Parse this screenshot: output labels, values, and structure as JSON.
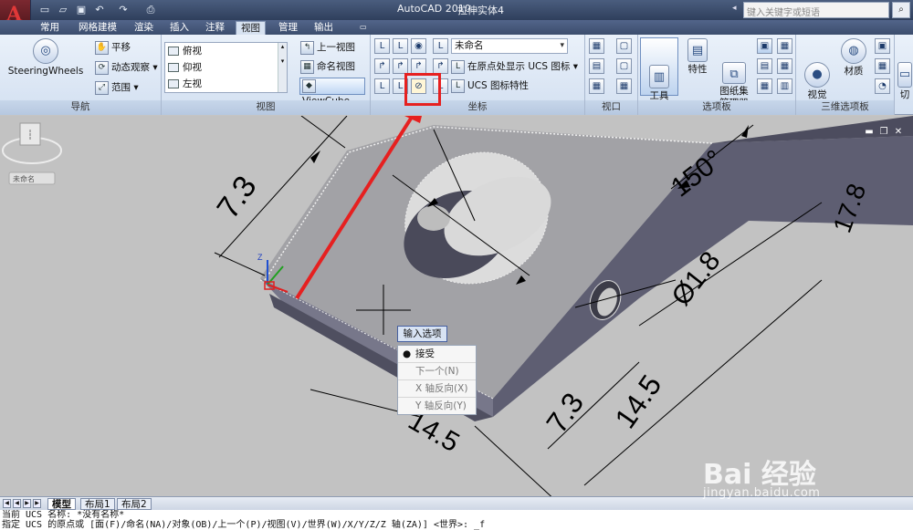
{
  "window": {
    "app_title": "AutoCAD 2010",
    "document": "拉伸实体4"
  },
  "help_search": {
    "placeholder": "键入关键字或短语"
  },
  "tabs": [
    "常用",
    "网格建模",
    "渲染",
    "插入",
    "注释",
    "视图",
    "管理",
    "输出"
  ],
  "active_tab": "视图",
  "panels": {
    "navigation": {
      "title": "导航",
      "steering": "SteeringWheels",
      "pan": "平移",
      "orbit": "动态观察",
      "extents": "范围"
    },
    "views": {
      "title": "视图",
      "list": [
        "俯视",
        "仰视",
        "左视"
      ],
      "prev_view": "上一视图",
      "named_view": "命名视图",
      "viewcube": "ViewCube"
    },
    "coordinates": {
      "title": "坐标",
      "ucs_name": "未命名",
      "show_ucs_origin": "在原点处显示 UCS 图标",
      "ucs_props": "UCS 图标特性"
    },
    "viewports": {
      "title": "视口"
    },
    "palettes": {
      "title": "选项板",
      "tool_palettes": "工具\n选项板",
      "properties": "特性",
      "sheet_set": "图纸集\n管理器"
    },
    "three_d_palettes": {
      "title": "三维选项板",
      "visual_styles": "视觉\n样式",
      "materials": "材质",
      "switch": "切\n"
    }
  },
  "drawing": {
    "dimensions": [
      "7.3",
      "150°",
      "17.8",
      "Ø1.8",
      "7.3",
      "14.5",
      "14.5"
    ],
    "axis_z": "Z",
    "viewcube_label": "未命名"
  },
  "context_menu": {
    "header": "输入选项",
    "items": [
      "接受",
      "下一个(N)",
      "X 轴反向(X)",
      "Y 轴反向(Y)"
    ],
    "selected_index": 0
  },
  "layout_tabs": [
    "模型",
    "布局1",
    "布局2"
  ],
  "active_layout": "模型",
  "command_lines": [
    "当前 UCS 名称: *没有名称*",
    "指定 UCS 的原点或 [面(F)/命名(NA)/对象(OB)/上一个(P)/视图(V)/世界(W)/X/Y/Z/Z 轴(ZA)] <世界>: _f"
  ],
  "watermark": {
    "brand": "Bai 经验",
    "url": "jingyan.baidu.com"
  },
  "colors": {
    "highlight": "#e62020",
    "ribbon_bg": "#dbe6f4",
    "titlebar": "#3a4c6c"
  }
}
